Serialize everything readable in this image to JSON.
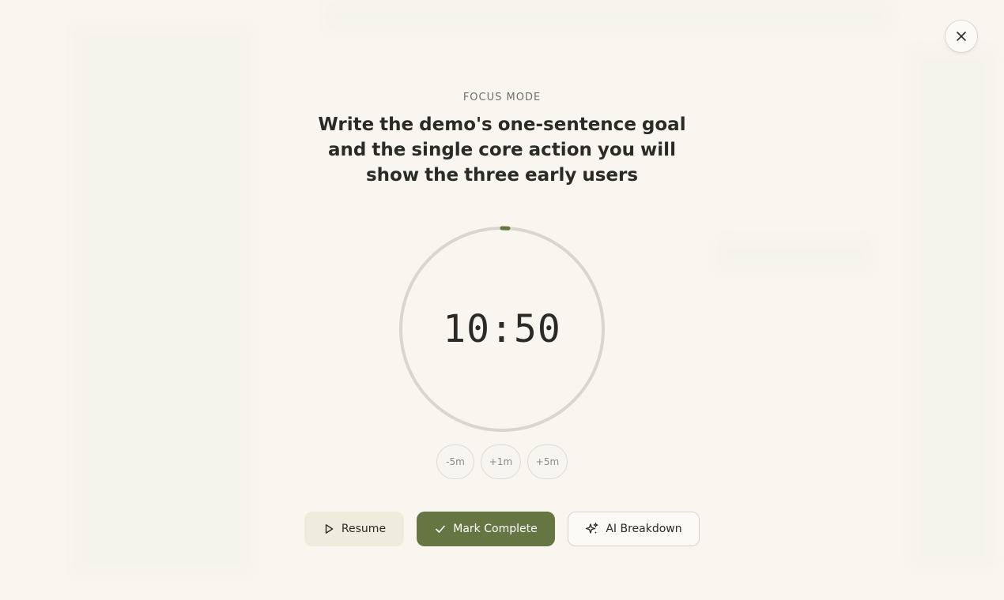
{
  "header": {
    "mode_label": "FOCUS MODE",
    "task_title": "Write the demo's one-sentence goal and the single core action you will show the three early users"
  },
  "timer": {
    "display": "10:50",
    "progress": 0.02,
    "ring_color": "#d8d6cd",
    "progress_color": "#657643"
  },
  "adjustments": [
    {
      "label": "-5m"
    },
    {
      "label": "+1m"
    },
    {
      "label": "+5m"
    }
  ],
  "actions": {
    "resume_label": "Resume",
    "complete_label": "Mark Complete",
    "ai_label": "AI Breakdown"
  },
  "icons": {
    "close": "close-icon",
    "resume": "play-icon",
    "complete": "check-icon",
    "ai": "sparkles-icon"
  },
  "colors": {
    "background": "#f6f4ec",
    "accent": "#657643",
    "text": "#2a2a26",
    "muted": "#6f6d66"
  }
}
